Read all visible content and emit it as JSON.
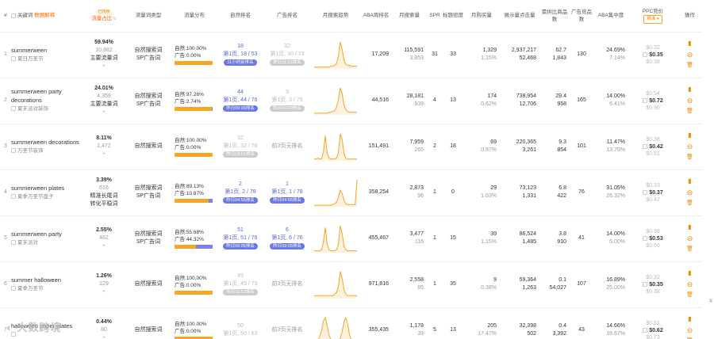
{
  "accent_color": "#f5a623",
  "headers": {
    "index": "#",
    "keyword": "关键词",
    "data_explain": "数据解释",
    "traffic_share": "流量占比",
    "traffic_share_badge": "已排序",
    "traffic_type": "流量词类型",
    "traffic_dist": "流量分布",
    "organic_rank": "自然排名",
    "ad_rank": "广告排名",
    "monthly_trend": "月搜索趋势",
    "aba_rank": "ABA周排名",
    "monthly_search": "月搜索量",
    "spr": "SPR",
    "title_density": "标题密度",
    "monthly_buy": "月购买量",
    "impressions_clicks": "展示量点击量",
    "demand_supply": "需供比商品数",
    "ad_competitors": "广告竞品数",
    "aba_concentration": "ABA集中度",
    "ppc": "PPC竞价",
    "ppc_button": "精准",
    "ppc_dropdown_icon": "chevron-down-icon",
    "actions": "操作"
  },
  "labels": {
    "organic": "自然:",
    "ad": "广告:"
  },
  "rows": [
    {
      "index": "1",
      "kw_en": "summerween",
      "kw_cn": "夏日万圣节",
      "share_pct": "59.94%",
      "share_count": "10,882",
      "share_tag": "主要流量词",
      "share_dash": "-",
      "type1": "自然搜索词",
      "type2": "SP广告词",
      "organic_pct": "100.00%",
      "ad_pct": "0.00%",
      "organic_frac": 1.0,
      "ad_frac": 0.0,
      "org_rank_num": "18",
      "org_rank_detail": "第1页, 18 / 53",
      "org_rank_pill": "11小时前排名",
      "org_pill_style": "blue",
      "org_active": true,
      "ad_rank_num": "32",
      "ad_rank_detail": "第1页, 30 / 73",
      "ad_rank_pill": "昨日11:52排名",
      "ad_pill_style": "grey",
      "ad_active": false,
      "trend": [
        2,
        2,
        2,
        2,
        2,
        2,
        2,
        2,
        2,
        3,
        3,
        4,
        6,
        14,
        30,
        22,
        10,
        5,
        4,
        4,
        3,
        3,
        3,
        3
      ],
      "aba": "17,209",
      "search1": "115,591",
      "search2": "3,853",
      "spr": "31",
      "density": "33",
      "buy1": "1,329",
      "buy2": "1.15%",
      "imp": "2,937,217",
      "clicks": "52,468",
      "ds1": "62.7",
      "ds2": "1,843",
      "ad_comp": "130",
      "aba_c1": "24.69%",
      "aba_c2": "7.14%",
      "ppc_low": "$0.32",
      "ppc_mid": "$0.35",
      "ppc_high": "$0.38"
    },
    {
      "index": "2",
      "kw_en": "summerween party decorations",
      "kw_cn": "夏末派对装饰",
      "share_pct": "24.01%",
      "share_count": "4,359",
      "share_tag": "主要流量词",
      "share_dash": "-",
      "type1": "自然搜索词",
      "type2": "SP广告词",
      "organic_pct": "97.26%",
      "ad_pct": "2.74%",
      "organic_frac": 0.9726,
      "ad_frac": 0.0274,
      "org_rank_num": "44",
      "org_rank_detail": "第1页, 44 / 76",
      "org_rank_pill": "昨日09:09排名",
      "org_pill_style": "blue",
      "org_active": true,
      "ad_rank_num": "3",
      "ad_rank_detail": "第1页, 3 / 79",
      "ad_rank_pill": "昨日09:09排名",
      "ad_pill_style": "grey",
      "ad_active": false,
      "trend": [
        2,
        2,
        2,
        2,
        2,
        2,
        2,
        2,
        3,
        3,
        4,
        5,
        9,
        18,
        32,
        26,
        12,
        6,
        4,
        3,
        3,
        3,
        3,
        3
      ],
      "aba": "44,516",
      "search1": "28,181",
      "search2": "939",
      "spr": "4",
      "density": "13",
      "buy1": "174",
      "buy2": "0.62%",
      "imp": "738,954",
      "clicks": "12,706",
      "ds1": "29.4",
      "ds2": "958",
      "ad_comp": "165",
      "aba_c1": "14.00%",
      "aba_c2": "6.41%",
      "ppc_low": "$0.54",
      "ppc_mid": "$0.72",
      "ppc_high": "$0.90"
    },
    {
      "index": "3",
      "kw_en": "summerween decorations",
      "kw_cn": "万圣节装饰",
      "share_pct": "8.11%",
      "share_count": "1,472",
      "share_tag": "",
      "share_dash": "-",
      "type1": "自然搜索词",
      "type2": "",
      "organic_pct": "100.00%",
      "ad_pct": "0.00%",
      "organic_frac": 1.0,
      "ad_frac": 0.0,
      "org_rank_num": "32",
      "org_rank_detail": "第1页, 32 / 76",
      "org_rank_pill": "昨日19:51排名",
      "org_pill_style": "grey",
      "org_active": false,
      "ad_rank_num": "",
      "ad_rank_detail": "前3页无排名",
      "ad_rank_pill": "",
      "ad_pill_style": "grey",
      "ad_active": false,
      "trend": [
        2,
        2,
        3,
        2,
        2,
        10,
        28,
        8,
        3,
        2,
        2,
        2,
        3,
        9,
        30,
        24,
        8,
        3,
        2,
        2,
        2,
        2,
        2,
        2
      ],
      "aba": "151,491",
      "search1": "7,959",
      "search2": "265",
      "spr": "2",
      "density": "18",
      "buy1": "69",
      "buy2": "0.87%",
      "imp": "220,365",
      "clicks": "3,261",
      "ds1": "9.3",
      "ds2": "854",
      "ad_comp": "101",
      "aba_c1": "11.47%",
      "aba_c2": "13.75%",
      "ppc_low": "$0.38",
      "ppc_mid": "$0.42",
      "ppc_high": "$0.51"
    },
    {
      "index": "4",
      "kw_en": "summerween plates",
      "kw_cn": "夏季万圣节盘子",
      "share_pct": "3.39%",
      "share_count": "616",
      "share_tag": "精准长尾词",
      "share_tag2": "转化平稳词",
      "share_dash": "",
      "type1": "自然搜索词",
      "type2": "SP广告词",
      "organic_pct": "89.13%",
      "ad_pct": "10.87%",
      "organic_frac": 0.8913,
      "ad_frac": 0.1087,
      "org_rank_num": "2",
      "org_rank_detail": "第1页, 2 / 78",
      "org_rank_pill": "昨日04:55排名",
      "org_pill_style": "blue",
      "org_active": true,
      "ad_rank_num": "1",
      "ad_rank_detail": "第1页, 1 / 78",
      "ad_rank_pill": "昨日04:55排名",
      "ad_pill_style": "blue",
      "ad_active": true,
      "trend": [
        2,
        2,
        2,
        2,
        2,
        2,
        2,
        2,
        2,
        2,
        3,
        4,
        6,
        12,
        22,
        18,
        8,
        4,
        3,
        3,
        3,
        3,
        3,
        36
      ],
      "aba": "358,254",
      "search1": "2,873",
      "search2": "96",
      "spr": "1",
      "density": "0",
      "buy1": "29",
      "buy2": "1.03%",
      "imp": "73,123",
      "clicks": "1,331",
      "ds1": "6.8",
      "ds2": "422",
      "ad_comp": "76",
      "aba_c1": "31.05%",
      "aba_c2": "26.32%",
      "ppc_low": "$0.33",
      "ppc_mid": "$0.37",
      "ppc_high": "$0.42"
    },
    {
      "index": "5",
      "kw_en": "summerween party",
      "kw_cn": "夏末派对",
      "share_pct": "2.55%",
      "share_count": "462",
      "share_tag": "",
      "share_dash": "-",
      "type1": "自然搜索词",
      "type2": "SP广告词",
      "organic_pct": "55.68%",
      "ad_pct": "44.32%",
      "organic_frac": 0.5568,
      "ad_frac": 0.4432,
      "org_rank_num": "51",
      "org_rank_detail": "第1页, 51 / 76",
      "org_rank_pill": "昨日09:05排名",
      "org_pill_style": "blue",
      "org_active": true,
      "ad_rank_num": "6",
      "ad_rank_detail": "第1页, 6 / 76",
      "ad_rank_pill": "昨日09:05排名",
      "ad_pill_style": "blue",
      "ad_active": true,
      "trend": [
        2,
        2,
        2,
        2,
        3,
        12,
        26,
        9,
        3,
        2,
        2,
        2,
        3,
        8,
        28,
        20,
        7,
        3,
        2,
        2,
        2,
        2,
        2,
        2
      ],
      "aba": "455,467",
      "search1": "3,477",
      "search2": "116",
      "spr": "1",
      "density": "15",
      "buy1": "39",
      "buy2": "1.15%",
      "imp": "86,524",
      "clicks": "1,485",
      "ds1": "3.8",
      "ds2": "910",
      "ad_comp": "41",
      "aba_c1": "14.00%",
      "aba_c2": "5.00%",
      "ppc_low": "$0.38",
      "ppc_mid": "$0.53",
      "ppc_high": "$0.66"
    },
    {
      "index": "6",
      "kw_en": "summer halloween",
      "kw_cn": "夏季万圣节",
      "share_pct": "1.26%",
      "share_count": "229",
      "share_tag": "",
      "share_dash": "-",
      "type1": "自然搜索词",
      "type2": "",
      "organic_pct": "100.00%",
      "ad_pct": "0.00%",
      "organic_frac": 1.0,
      "ad_frac": 0.0,
      "org_rank_num": "49",
      "org_rank_detail": "第1页, 49 / 73",
      "org_rank_pill": "昨日11:52排名",
      "org_pill_style": "grey",
      "org_active": false,
      "ad_rank_num": "",
      "ad_rank_detail": "前3页无排名",
      "ad_rank_pill": "",
      "ad_pill_style": "grey",
      "ad_active": false,
      "trend": [
        2,
        2,
        2,
        2,
        2,
        2,
        2,
        2,
        2,
        2,
        2,
        3,
        4,
        8,
        18,
        14,
        6,
        3,
        2,
        2,
        2,
        2,
        2,
        2
      ],
      "aba": "971,816",
      "search1": "2,558",
      "search2": "85",
      "spr": "1",
      "density": "35",
      "buy1": "9",
      "buy2": "0.38%",
      "imp": "59,364",
      "clicks": "1,263",
      "ds1": "0.1",
      "ds2": "54,027",
      "ad_comp": "107",
      "aba_c1": "16.89%",
      "aba_c2": "25.00%",
      "ppc_low": "$0.32",
      "ppc_mid": "$0.35",
      "ppc_high": "$0.38"
    },
    {
      "index": "7",
      "kw_en": "halloween paper plates",
      "kw_cn": "",
      "share_pct": "0.44%",
      "share_count": "80",
      "share_tag": "",
      "share_dash": "-",
      "type1": "自然搜索词",
      "type2": "",
      "organic_pct": "100.00%",
      "ad_pct": "0.00%",
      "organic_frac": 1.0,
      "ad_frac": 0.0,
      "org_rank_num": "50",
      "org_rank_detail": "第1页, 50 / 63",
      "org_rank_pill": "",
      "org_pill_style": "grey",
      "org_active": false,
      "ad_rank_num": "",
      "ad_rank_detail": "前3页无排名",
      "ad_rank_pill": "",
      "ad_pill_style": "grey",
      "ad_active": false,
      "trend": [
        3,
        4,
        6,
        10,
        18,
        30,
        34,
        24,
        12,
        6,
        4,
        3,
        3,
        4,
        8,
        16,
        28,
        34,
        26,
        12,
        6,
        4,
        3,
        3
      ],
      "aba": "355,435",
      "search1": "1,178",
      "search2": "39",
      "spr": "5",
      "density": "13",
      "buy1": "205",
      "buy2": "17.47%",
      "imp": "32,398",
      "clicks": "502",
      "ds1": "0.4",
      "ds2": "3,392",
      "ad_comp": "43",
      "aba_c1": "14.66%",
      "aba_c2": "16.67%",
      "ppc_low": "$0.51",
      "ppc_mid": "$0.62",
      "ppc_high": "$0.73"
    }
  ],
  "action_icons": [
    "bar-chart-icon",
    "minus-circle-icon",
    "trash-icon"
  ],
  "watermark": "大数跨境",
  "scroll_to_top": "#"
}
